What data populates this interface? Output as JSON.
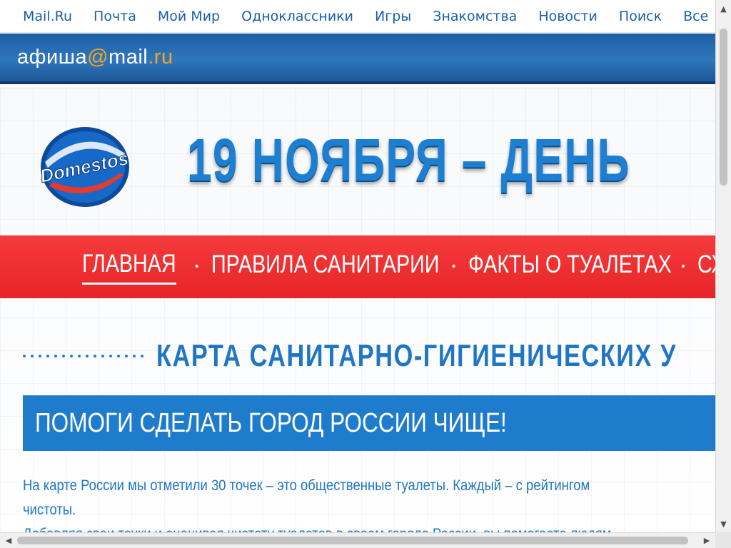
{
  "portal_nav": {
    "items": [
      "Mail.Ru",
      "Почта",
      "Мой Мир",
      "Одноклассники",
      "Игры",
      "Знакомства",
      "Новости",
      "Поиск",
      "Все"
    ]
  },
  "afisha": {
    "logo_word": "афиша",
    "logo_at": "@",
    "logo_mail": "mail",
    "logo_dot": ".",
    "logo_ru": "ru"
  },
  "promo": {
    "brand": "Domestos",
    "headline": "19 НОЯБРЯ – ДЕНЬ",
    "nav": {
      "items": [
        "ГЛАВНАЯ",
        "ПРАВИЛА САНИТАРИИ",
        "ФАКТЫ О ТУАЛЕТАХ",
        "СХЕМ"
      ],
      "active_index": 0,
      "separator": "•"
    },
    "map_title": "КАРТА САНИТАРНО-ГИГИЕНИЧЕСКИХ У",
    "banner": "ПОМОГИ СДЕЛАТЬ ГОРОД РОССИИ ЧИЩЕ!",
    "body_lines": [
      "На карте России мы отметили 30 точек – это общественные туалеты. Каждый – с рейтингом",
      "чистоты.",
      "Добавляя свои точки и оценивая чистоту туалетов в своем городе России, вы помогаете людям"
    ]
  },
  "colors": {
    "link_blue": "#1a5fa8",
    "afisha_blue": "#2e76bd",
    "accent_orange": "#f7a51c",
    "promo_red": "#e72528",
    "promo_blue": "#1f7ccd"
  },
  "icons": {
    "scroll_up": "▲",
    "scroll_down": "▼",
    "scroll_left": "◀",
    "scroll_right": "▶"
  }
}
